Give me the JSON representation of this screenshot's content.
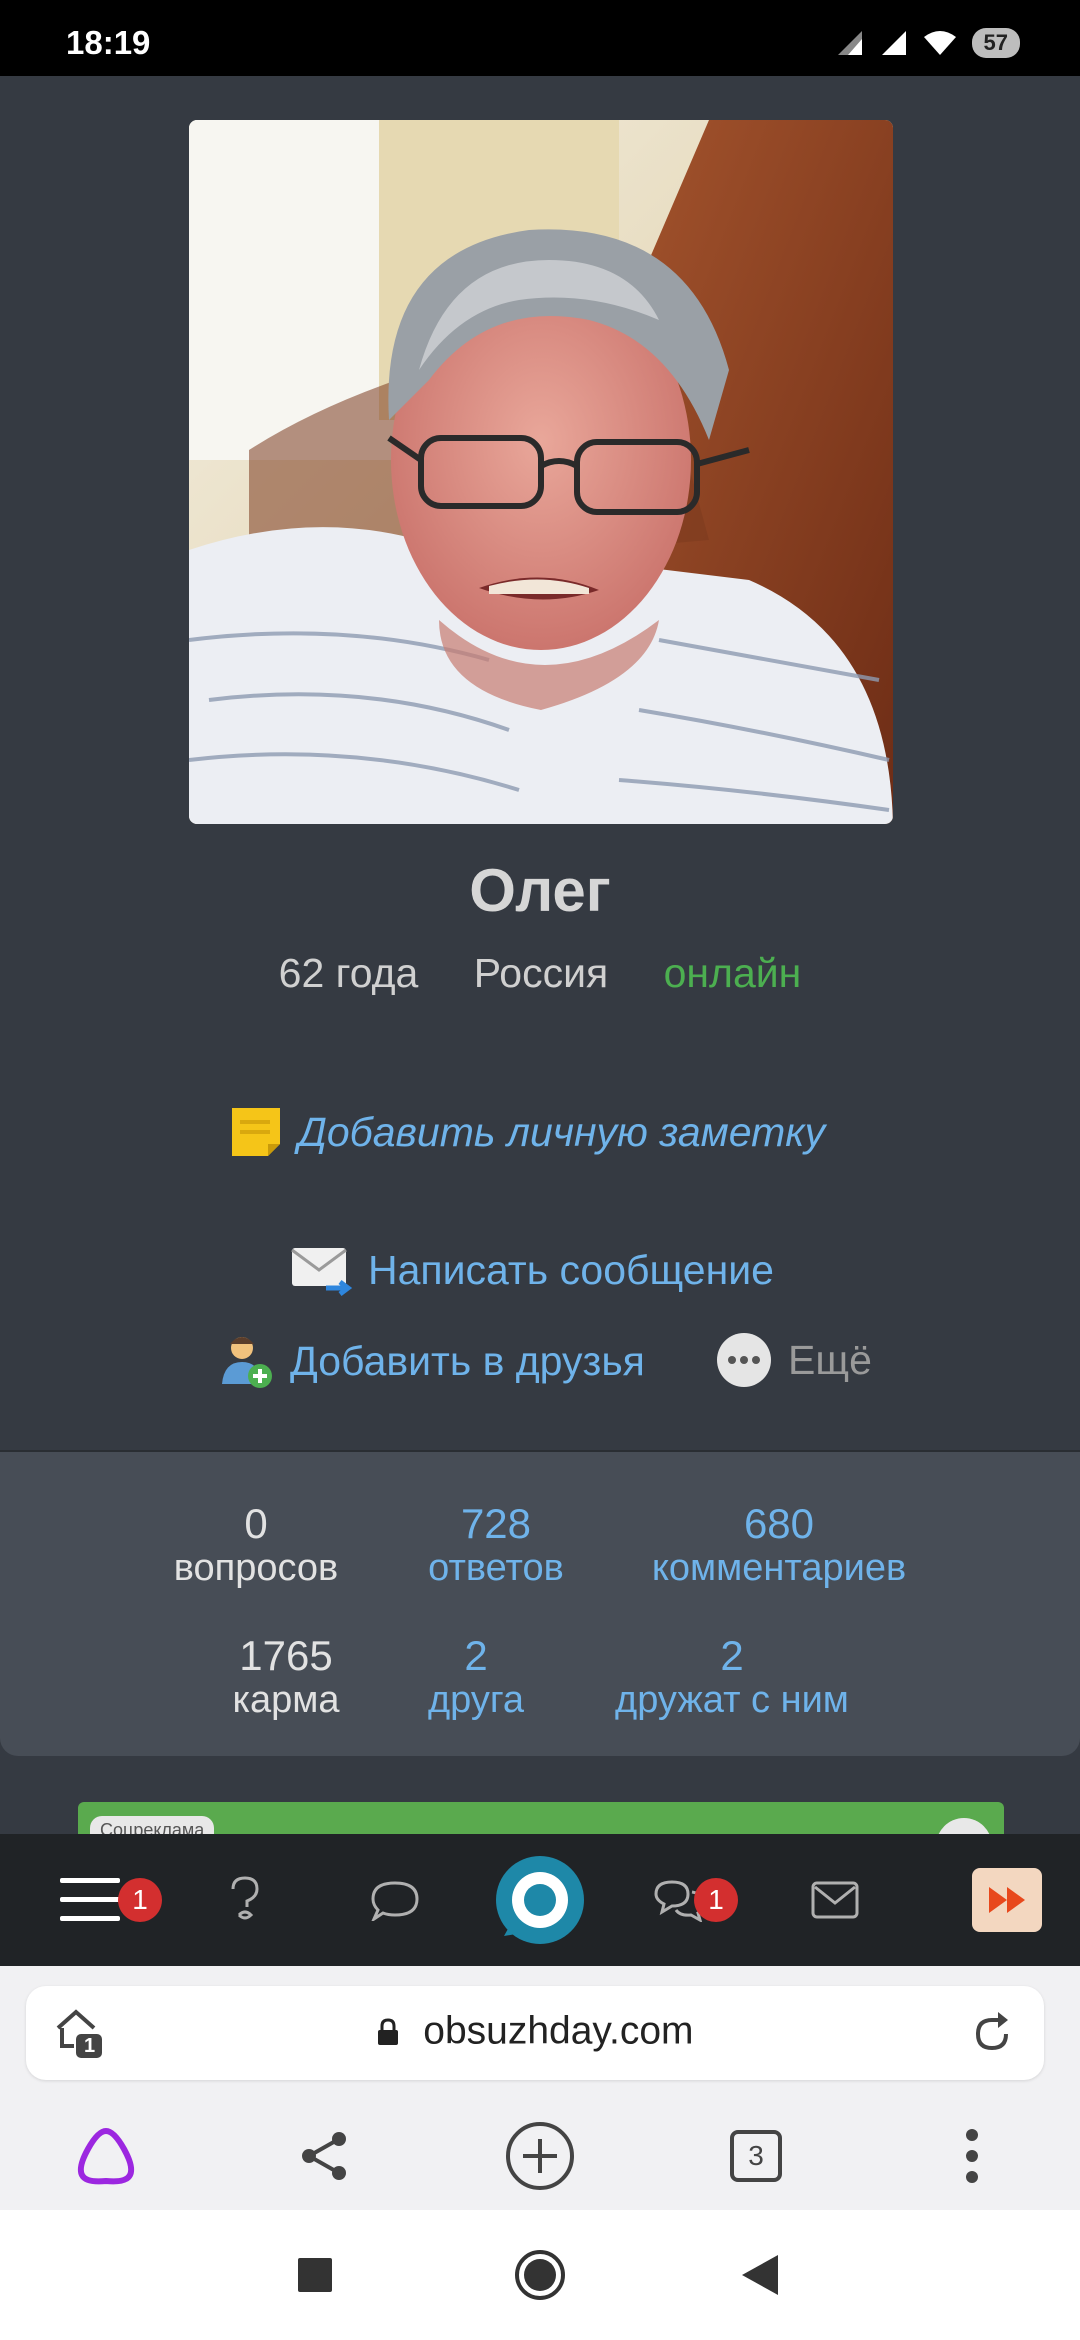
{
  "status_bar": {
    "time": "18:19",
    "battery": "57"
  },
  "profile": {
    "name": "Олег",
    "age": "62 года",
    "country": "Россия",
    "status": "онлайн",
    "avatar_alt": "profile-photo"
  },
  "actions": {
    "note": "Добавить личную заметку",
    "message": "Написать сообщение",
    "add_friend": "Добавить в друзья",
    "more": "Ещё"
  },
  "stats": {
    "questions": {
      "value": "0",
      "label": "вопросов"
    },
    "answers": {
      "value": "728",
      "label": "ответов"
    },
    "comments": {
      "value": "680",
      "label": "комментариев"
    },
    "karma": {
      "value": "1765",
      "label": "карма"
    },
    "friends": {
      "value": "2",
      "label": "друга"
    },
    "friend_of": {
      "value": "2",
      "label": "дружат с ним"
    }
  },
  "ad": {
    "label": "Соцреклама"
  },
  "site_toolbar": {
    "menu_badge": "1",
    "chats_badge": "1"
  },
  "browser": {
    "url": "obsuzhday.com",
    "tab_count": "3",
    "history_count": "1"
  },
  "colors": {
    "background": "#353a42",
    "link": "#6fb3ea",
    "online": "#4caf50",
    "badge": "#d32f2f",
    "stats_bg": "#474d56",
    "toolbar_bg": "#202326"
  }
}
